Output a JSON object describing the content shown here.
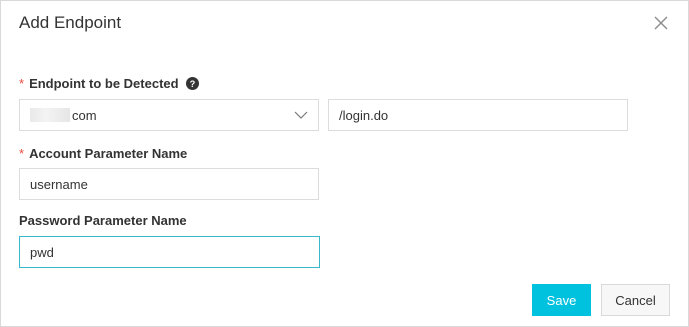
{
  "dialog": {
    "title": "Add Endpoint",
    "close_icon": "close-icon"
  },
  "endpoint": {
    "required_mark": "*",
    "label": "Endpoint to be Detected",
    "help_icon": "question-circle-icon",
    "domain_select": {
      "value_suffix": "com",
      "chevron_icon": "chevron-down-icon"
    },
    "path_value": "/login.do"
  },
  "account": {
    "required_mark": "*",
    "label": "Account Parameter Name",
    "value": "username"
  },
  "password": {
    "label": "Password Parameter Name",
    "value": "pwd"
  },
  "footer": {
    "save_label": "Save",
    "cancel_label": "Cancel"
  },
  "colors": {
    "accent": "#00c1de",
    "focus_border": "#39b7cd",
    "required": "#e84a3c"
  }
}
